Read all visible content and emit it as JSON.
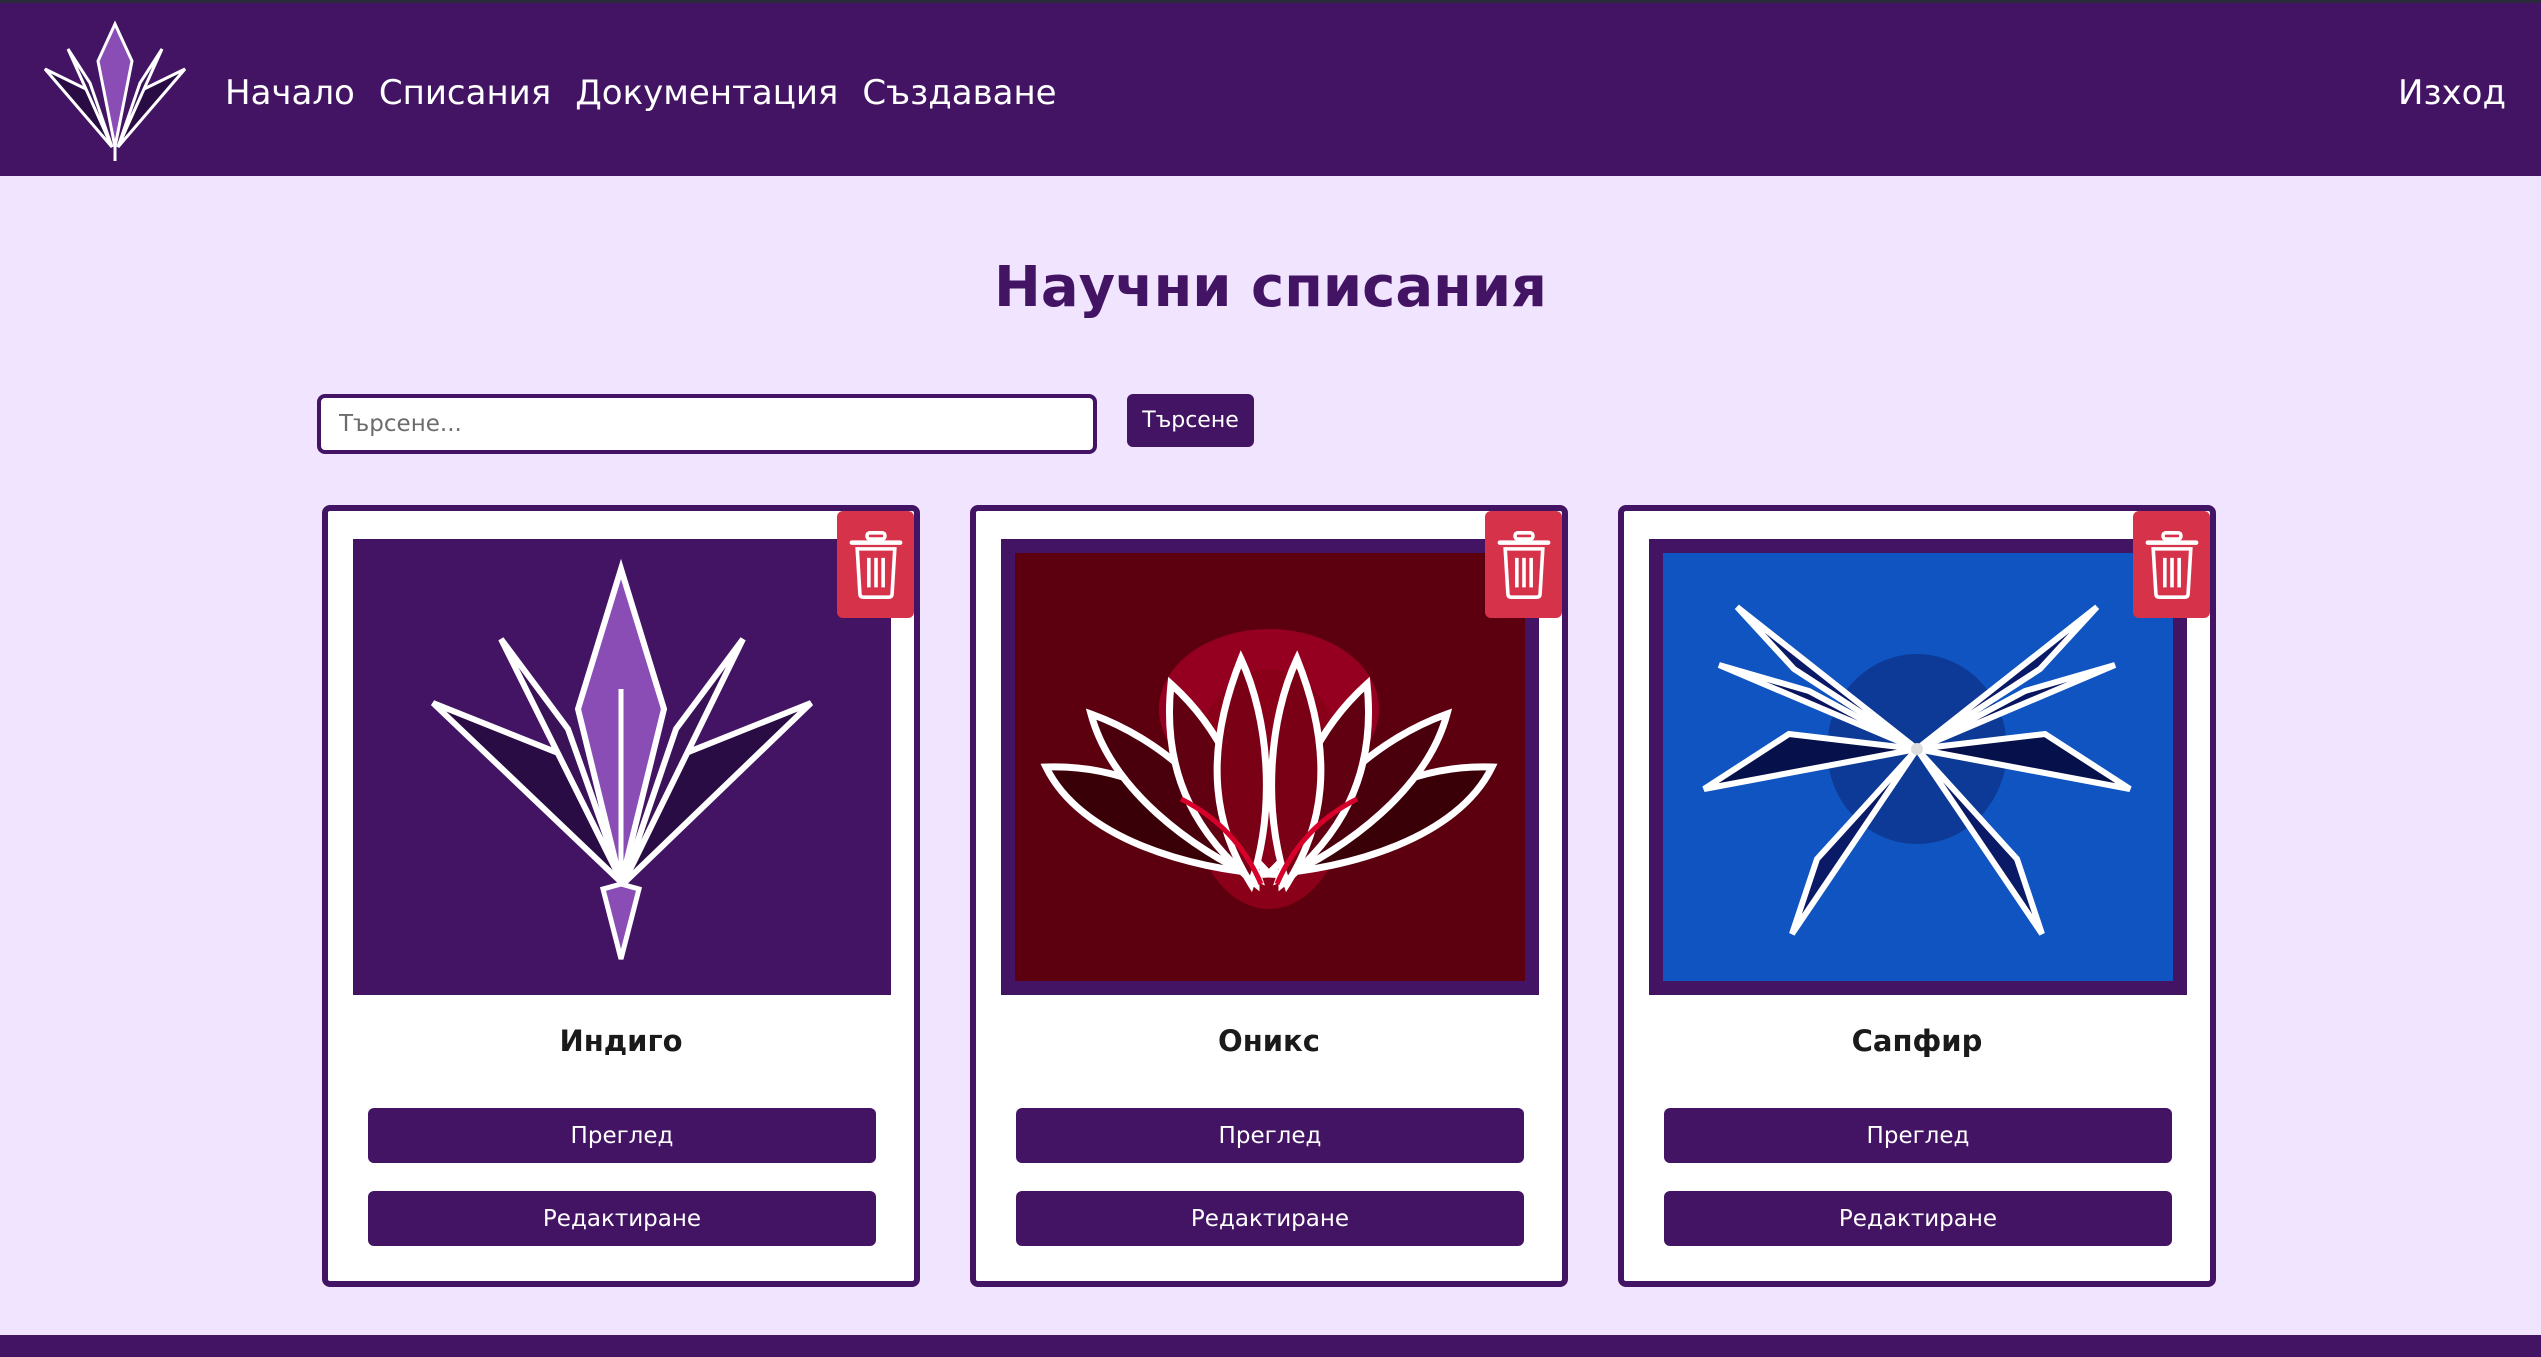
{
  "nav": {
    "links": [
      "Начало",
      "Списания",
      "Документация",
      "Създаване"
    ],
    "logout": "Изход"
  },
  "page": {
    "title": "Научни списания"
  },
  "search": {
    "placeholder": "Търсене...",
    "button_label": "Търсене"
  },
  "journals": [
    {
      "name": "Индиго",
      "view_label": "Преглед",
      "edit_label": "Редактиране"
    },
    {
      "name": "Оникс",
      "view_label": "Преглед",
      "edit_label": "Редактиране"
    },
    {
      "name": "Сапфир",
      "view_label": "Преглед",
      "edit_label": "Редактиране"
    }
  ],
  "colors": {
    "primary": "#431463",
    "page_background": "#f0e4ff",
    "danger": "#d6334b",
    "card_background": "#ffffff"
  }
}
